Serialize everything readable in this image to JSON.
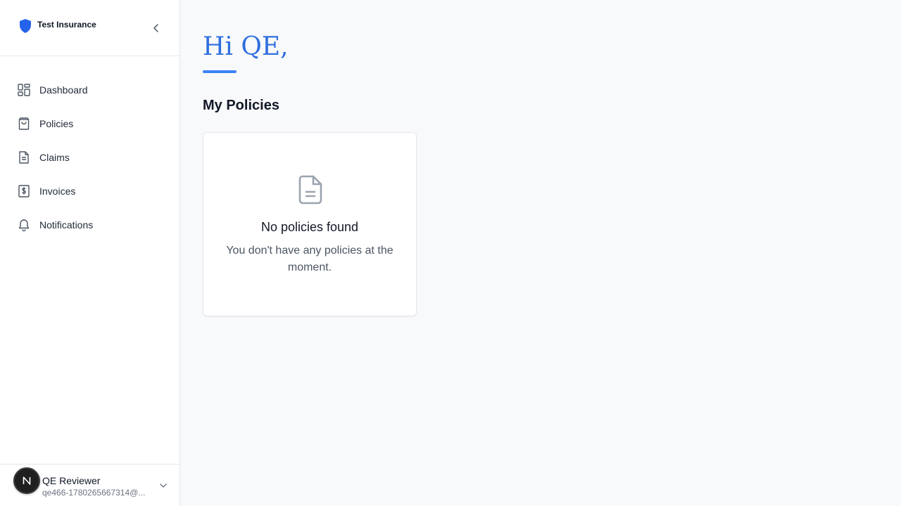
{
  "brand": {
    "name": "Test Insurance",
    "logo_icon": "shield-icon",
    "accent_color": "#2563eb"
  },
  "sidebar": {
    "collapse_icon": "chevron-left-icon",
    "items": [
      {
        "label": "Dashboard",
        "icon": "dashboard-icon"
      },
      {
        "label": "Policies",
        "icon": "shopping-bag-icon"
      },
      {
        "label": "Claims",
        "icon": "document-icon"
      },
      {
        "label": "Invoices",
        "icon": "dollar-receipt-icon"
      },
      {
        "label": "Notifications",
        "icon": "bell-icon"
      }
    ]
  },
  "user": {
    "avatar_letter": "N",
    "name": "QE Reviewer",
    "email": "qe466-1780265667314@...",
    "menu_icon": "chevron-down-icon"
  },
  "main": {
    "greeting": "Hi QE,",
    "section_title": "My Policies",
    "empty_state": {
      "icon": "document-icon",
      "title": "No policies found",
      "description": "You don't have any policies at the moment."
    }
  }
}
